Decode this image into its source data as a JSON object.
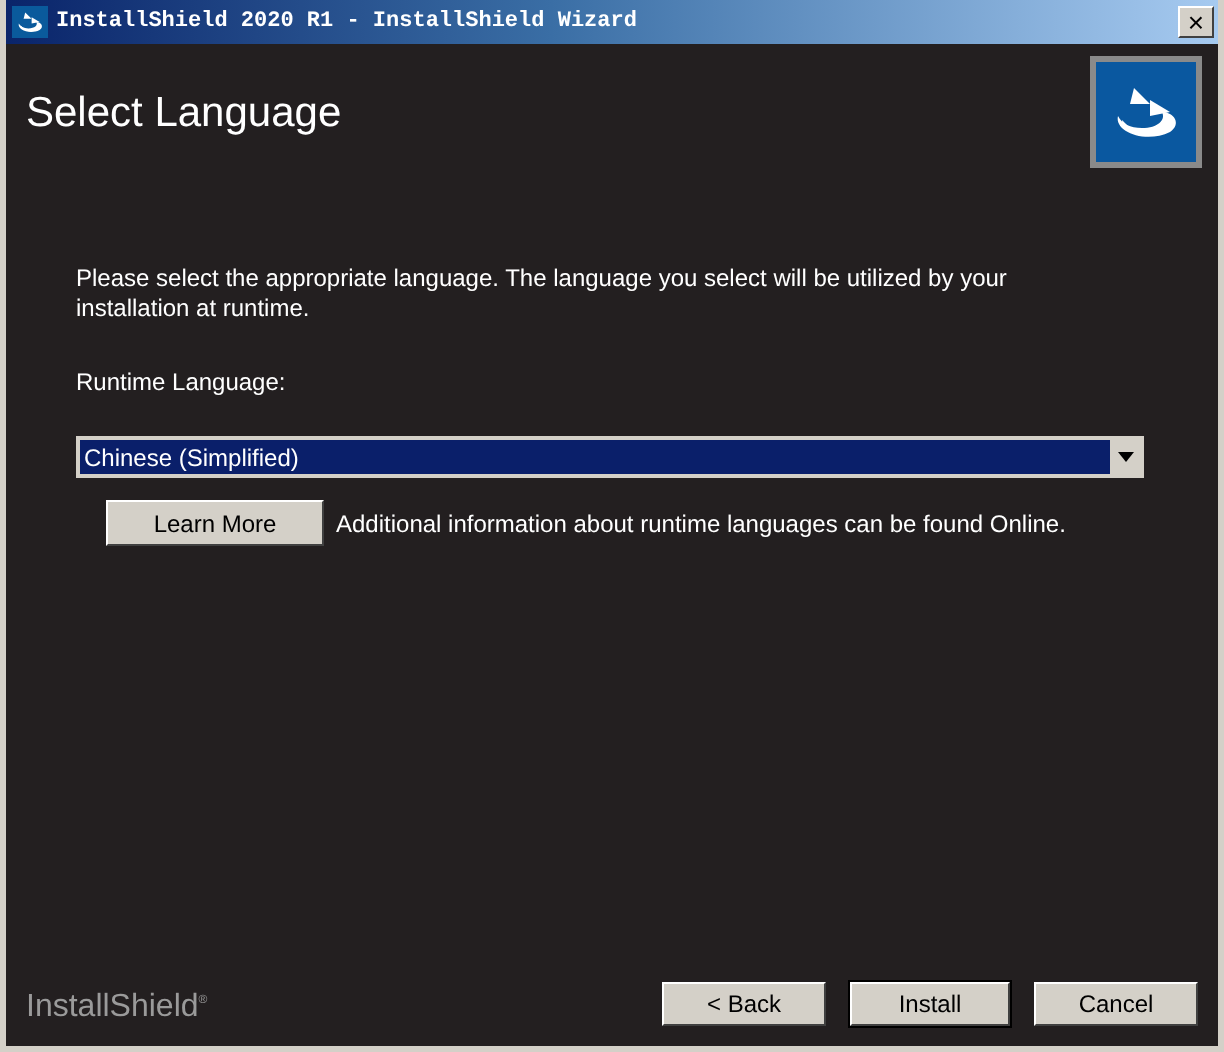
{
  "window": {
    "title": "InstallShield 2020 R1 - InstallShield Wizard",
    "close": "×"
  },
  "header": {
    "title": "Select Language"
  },
  "intro": "Please select the appropriate language. The language you select will be utilized by your installation at runtime.",
  "language_field": {
    "label": "Runtime Language:",
    "value": "Chinese (Simplified)"
  },
  "learn_more": {
    "button": "Learn More",
    "text": "Additional information about runtime languages can be found Online."
  },
  "brand": "InstallShield$^{®}$",
  "buttons": [
    {
      "label": "< Back",
      "default": false
    },
    {
      "label": "Install",
      "default": true
    },
    {
      "label": "Cancel",
      "default": false
    }
  ]
}
